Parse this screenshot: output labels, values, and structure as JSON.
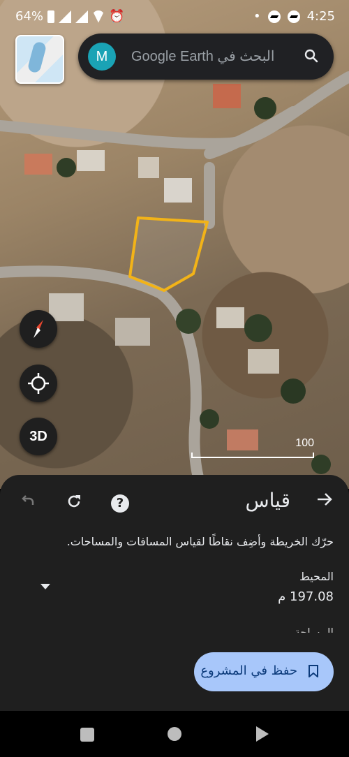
{
  "status_bar": {
    "battery": "64%",
    "time": "4:25"
  },
  "search": {
    "avatar_letter": "M",
    "placeholder": "البحث في Google Earth"
  },
  "map_controls": {
    "three_d_label": "3D",
    "scale_label": "100"
  },
  "measure_panel": {
    "title": "قياس",
    "instructions": "حرّك الخريطة وأضِف نقاطًا لقياس المسافات والمساحات.",
    "perimeter_label": "المحيط",
    "perimeter_value": "197.08 م",
    "area_label": "المساحة",
    "save_button_label": "حفظ في المشروع"
  },
  "colors": {
    "accent": "#a8c7fa",
    "polygon": "#f2b318",
    "sheet_bg": "#1f1f1f"
  }
}
